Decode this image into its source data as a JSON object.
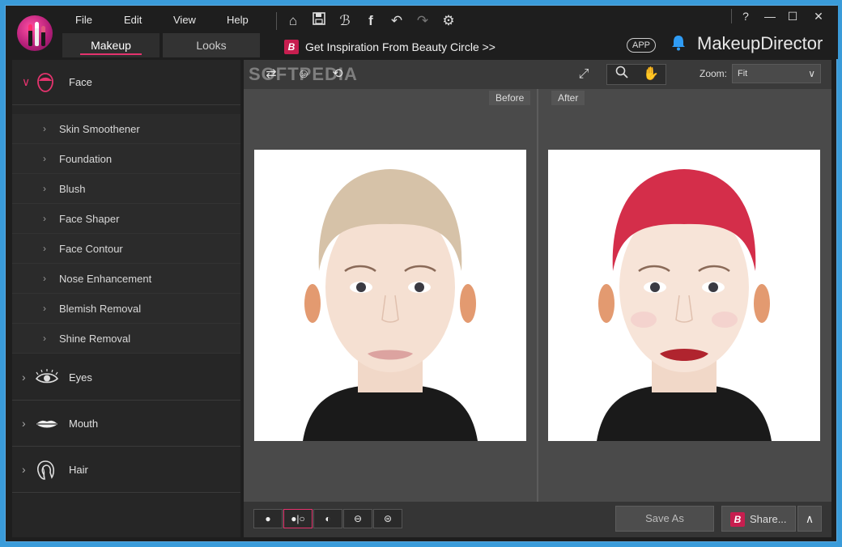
{
  "menu": [
    "File",
    "Edit",
    "View",
    "Help"
  ],
  "tabs": [
    {
      "label": "Makeup",
      "active": true
    },
    {
      "label": "Looks",
      "active": false
    }
  ],
  "inspiration": {
    "badge": "B",
    "text": "Get Inspiration From Beauty Circle >>"
  },
  "app_badge": "APP",
  "brand": "MakeupDirector",
  "window_controls": {
    "help": "?",
    "minimize": "—",
    "maximize": "☐",
    "close": "✕"
  },
  "toolbar_icons": {
    "home": "⌂",
    "save": "💾",
    "beauty": "ℬ",
    "facebook": "f",
    "undo": "↶",
    "redo": "↷",
    "settings": "⚙"
  },
  "sidebar": {
    "face": {
      "label": "Face",
      "expanded": true
    },
    "face_items": [
      "Skin Smoothener",
      "Foundation",
      "Blush",
      "Face Shaper",
      "Face Contour",
      "Nose Enhancement",
      "Blemish Removal",
      "Shine Removal"
    ],
    "eyes": {
      "label": "Eyes"
    },
    "mouth": {
      "label": "Mouth"
    },
    "hair": {
      "label": "Hair"
    }
  },
  "canvas_toolbar": {
    "zoom_label": "Zoom:",
    "zoom_value": "Fit"
  },
  "panes": {
    "before": "Before",
    "after": "After"
  },
  "watermark": "SOFTPEDIA",
  "bottom": {
    "save_as": "Save As",
    "share": "Share...",
    "share_badge": "B"
  },
  "colors": {
    "accent": "#e5336e",
    "brand_badge": "#c71e4f",
    "bell": "#2f9cf5",
    "frame": "#3a9bd9",
    "hair_before": "#d6c2a8",
    "hair_after": "#d42e4a"
  }
}
